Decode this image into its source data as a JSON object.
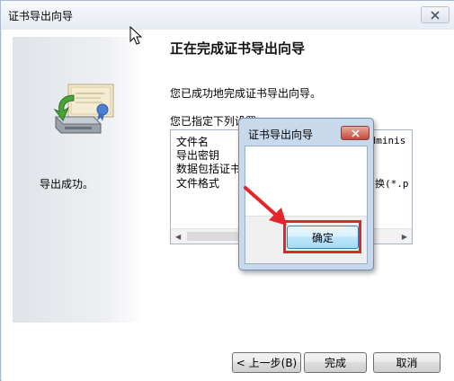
{
  "window": {
    "title": "证书导出向导"
  },
  "wizard": {
    "heading": "正在完成证书导出向导",
    "done_message": "您已成功地完成证书导出向导。",
    "spec_label": "您已指定下列设置:",
    "settings": [
      {
        "name": "文件名",
        "value": "Adminis"
      },
      {
        "name": "导出密钥",
        "value": ""
      },
      {
        "name": "数据包括证书",
        "value": ""
      },
      {
        "name": "文件格式",
        "value": "换(*.p"
      }
    ],
    "buttons": {
      "back": "< 上一步(B)",
      "finish": "完成",
      "cancel": "取消"
    }
  },
  "popup": {
    "title": "证书导出向导",
    "message": "导出成功。",
    "ok_label": "确定"
  },
  "icons": {
    "certificate": "certificate-export-icon",
    "close": "close-icon",
    "cursor": "mouse-cursor-icon",
    "annotation_arrow": "red-arrow-icon"
  },
  "colors": {
    "highlight": "#e3262b",
    "popup_frame": "#c9d9ec",
    "close_red": "#c4473a"
  }
}
